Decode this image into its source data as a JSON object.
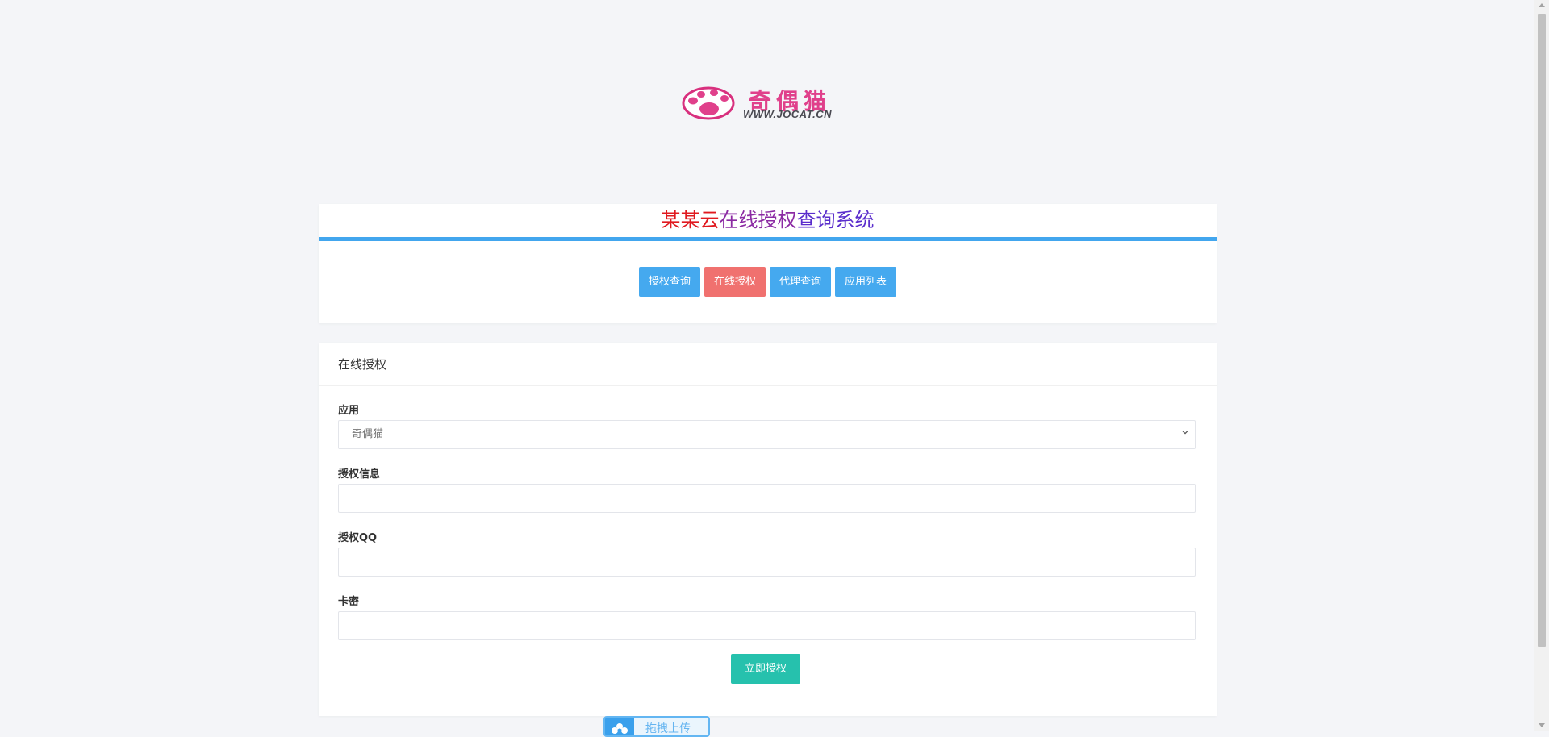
{
  "logo": {
    "text_cn": "奇偶猫",
    "text_en": "WWW.JOCAT.CN",
    "brand_color": "#e0408b",
    "icon": "cat-paw-icon"
  },
  "header": {
    "title_part1": "某某云",
    "title_part2": "在线授权",
    "title_part3": "查询系统",
    "accent_color": "#42a6ee"
  },
  "nav": {
    "items": [
      {
        "label": "授权查询",
        "color": "#45a9ef"
      },
      {
        "label": "在线授权",
        "color": "#f0716f"
      },
      {
        "label": "代理查询",
        "color": "#45a9ef"
      },
      {
        "label": "应用列表",
        "color": "#45a9ef"
      }
    ]
  },
  "form": {
    "heading": "在线授权",
    "app_label": "应用",
    "app_selected": "奇偶猫",
    "auth_info_label": "授权信息",
    "auth_info_value": "",
    "auth_qq_label": "授权QQ",
    "auth_qq_value": "",
    "card_key_label": "卡密",
    "card_key_value": "",
    "submit_label": "立即授权",
    "submit_color": "#26c1ad"
  },
  "widget": {
    "label": "拖拽上传",
    "icon": "upload-flower-icon"
  }
}
